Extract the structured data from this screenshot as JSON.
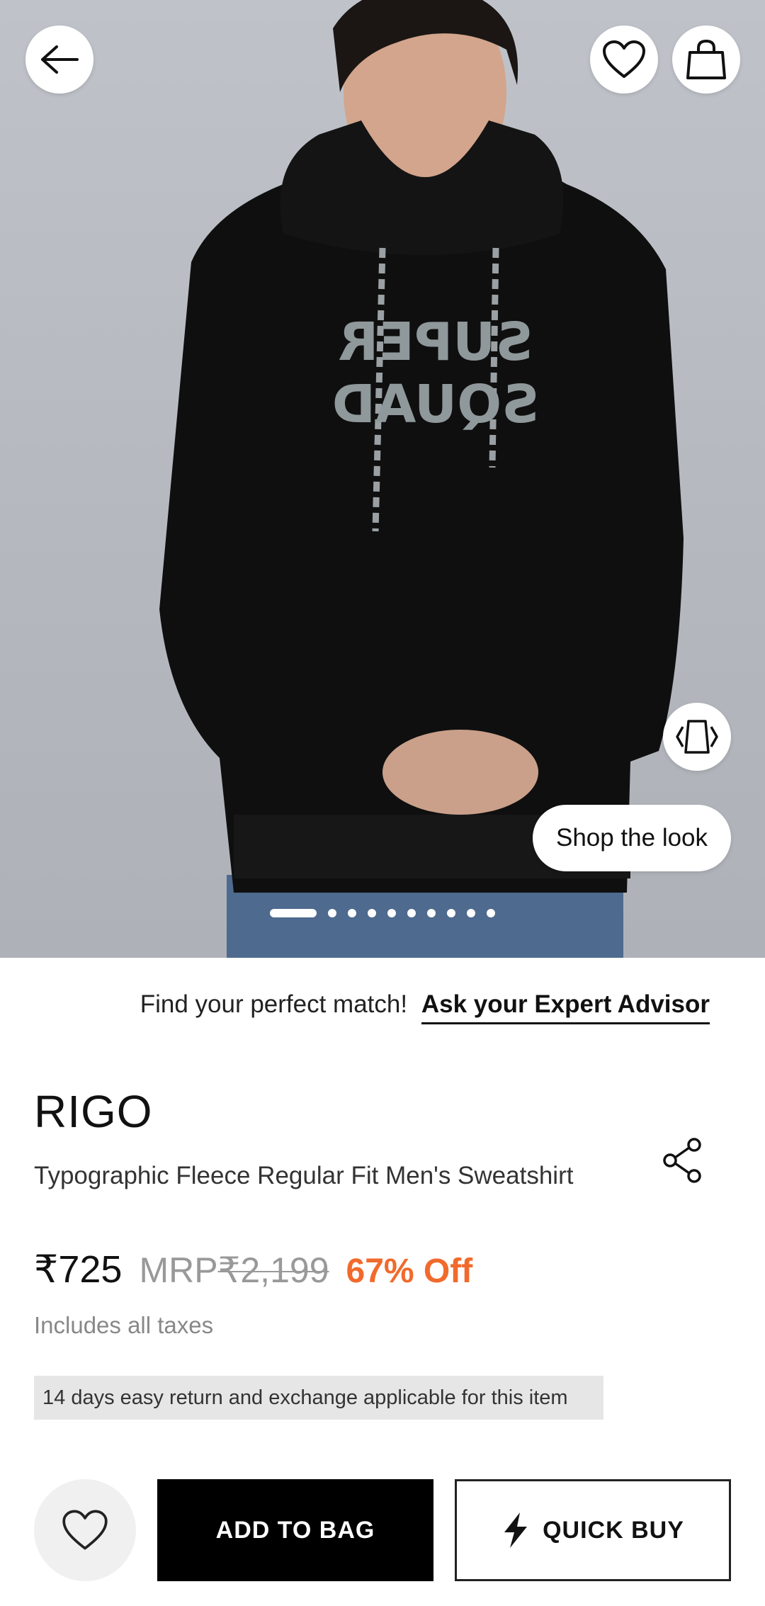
{
  "product_image": {
    "shirt_print": [
      "SUPER",
      "SQUAD"
    ],
    "active_image_index": 1,
    "image_count": 10
  },
  "header": {
    "back_icon": "arrow-left-icon",
    "wishlist_icon": "heart-icon",
    "bag_icon": "shopping-bag-icon"
  },
  "ar_icon": "3d-view-icon",
  "shop_the_look_label": "Shop the look",
  "advisor": {
    "prompt": "Find your perfect match!",
    "link": "Ask your Expert Advisor"
  },
  "product": {
    "brand": "RIGO",
    "title": "Typographic Fleece Regular Fit Men's Sweatshirt",
    "price": "₹725",
    "mrp_label": "MRP",
    "mrp_value": "₹2,199",
    "discount": "67% Off",
    "tax_note": "Includes all taxes",
    "return_note": "14 days easy return and exchange applicable for this item"
  },
  "actions": {
    "wishlist_icon": "heart-icon",
    "add_to_bag": "ADD TO BAG",
    "quick_buy": "QUICK BUY",
    "quick_buy_icon": "lightning-icon"
  },
  "colors": {
    "accent_discount": "#f16a2c",
    "primary_button": "#000000"
  }
}
